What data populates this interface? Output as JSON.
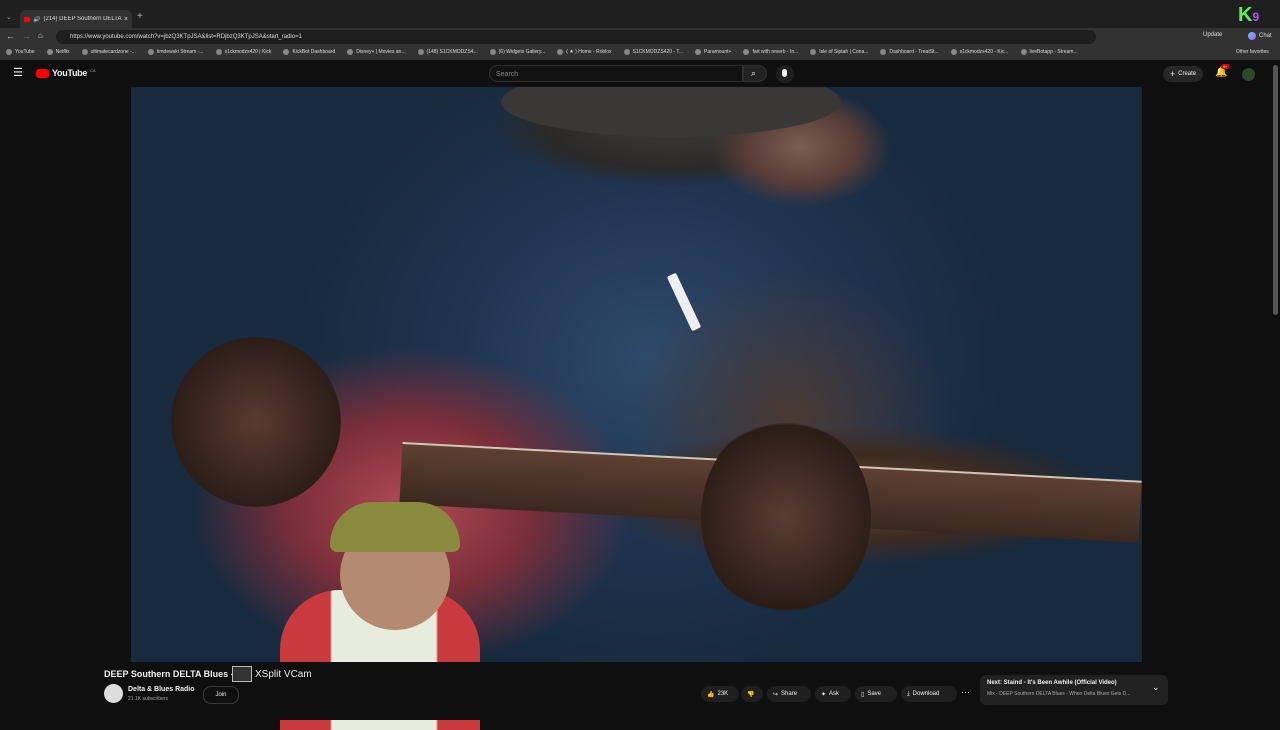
{
  "browser": {
    "tab_title": "(214) DEEP Southern DELTA",
    "url": "https://www.youtube.com/watch?v=jbzQ3KTpJSA&list=RDjbzQ3KTpJSA&start_radio=1",
    "update_label": "Update",
    "chat_label": "Chat",
    "bookmarks": [
      "YouTube",
      "Netflix",
      "ultimatecardzone -...",
      "timdewski Stream -...",
      "s1ckmodzs420 | Kick",
      "KickBot Dashboard",
      "Disney+ | Movies an...",
      "(148) S1CKMODZS4...",
      "(6) Widgets Gallery...",
      "( ★ ) Home - Roblox",
      "S1CKMODZS420 - T...",
      "Paramount+",
      "fart with reverb - In...",
      "Isle of Siptah | Cona...",
      "Dashboard - TreatSt...",
      "s1ckmodzs420 - Kic...",
      "liveBotapp - Stream..."
    ],
    "other_favorites": "Other favorites"
  },
  "youtube": {
    "logo_text": "YouTube",
    "region": "CA",
    "search_placeholder": "Search",
    "create_label": "Create",
    "notif_count": "9+"
  },
  "video": {
    "title": "DEEP Southern DELTA Blues - ",
    "channel": "Delta & Blues Radio",
    "subscribers": "21.1K subscribers",
    "join_label": "Join",
    "likes": "23K",
    "share_label": "Share",
    "ask_label": "Ask",
    "save_label": "Save",
    "download_label": "Download"
  },
  "overlay": {
    "vcam_label": "XSplit VCam"
  },
  "up_next": {
    "title": "Next: Staind - It's Been Awhile (Official Video)",
    "subtitle": "Mix - DEEP Southern DELTA Blues - When Delta Blues Gets D..."
  },
  "colors": {
    "yt_red": "#ff0000",
    "bg": "#0f0f0f",
    "accent_green": "#5bf05b"
  }
}
